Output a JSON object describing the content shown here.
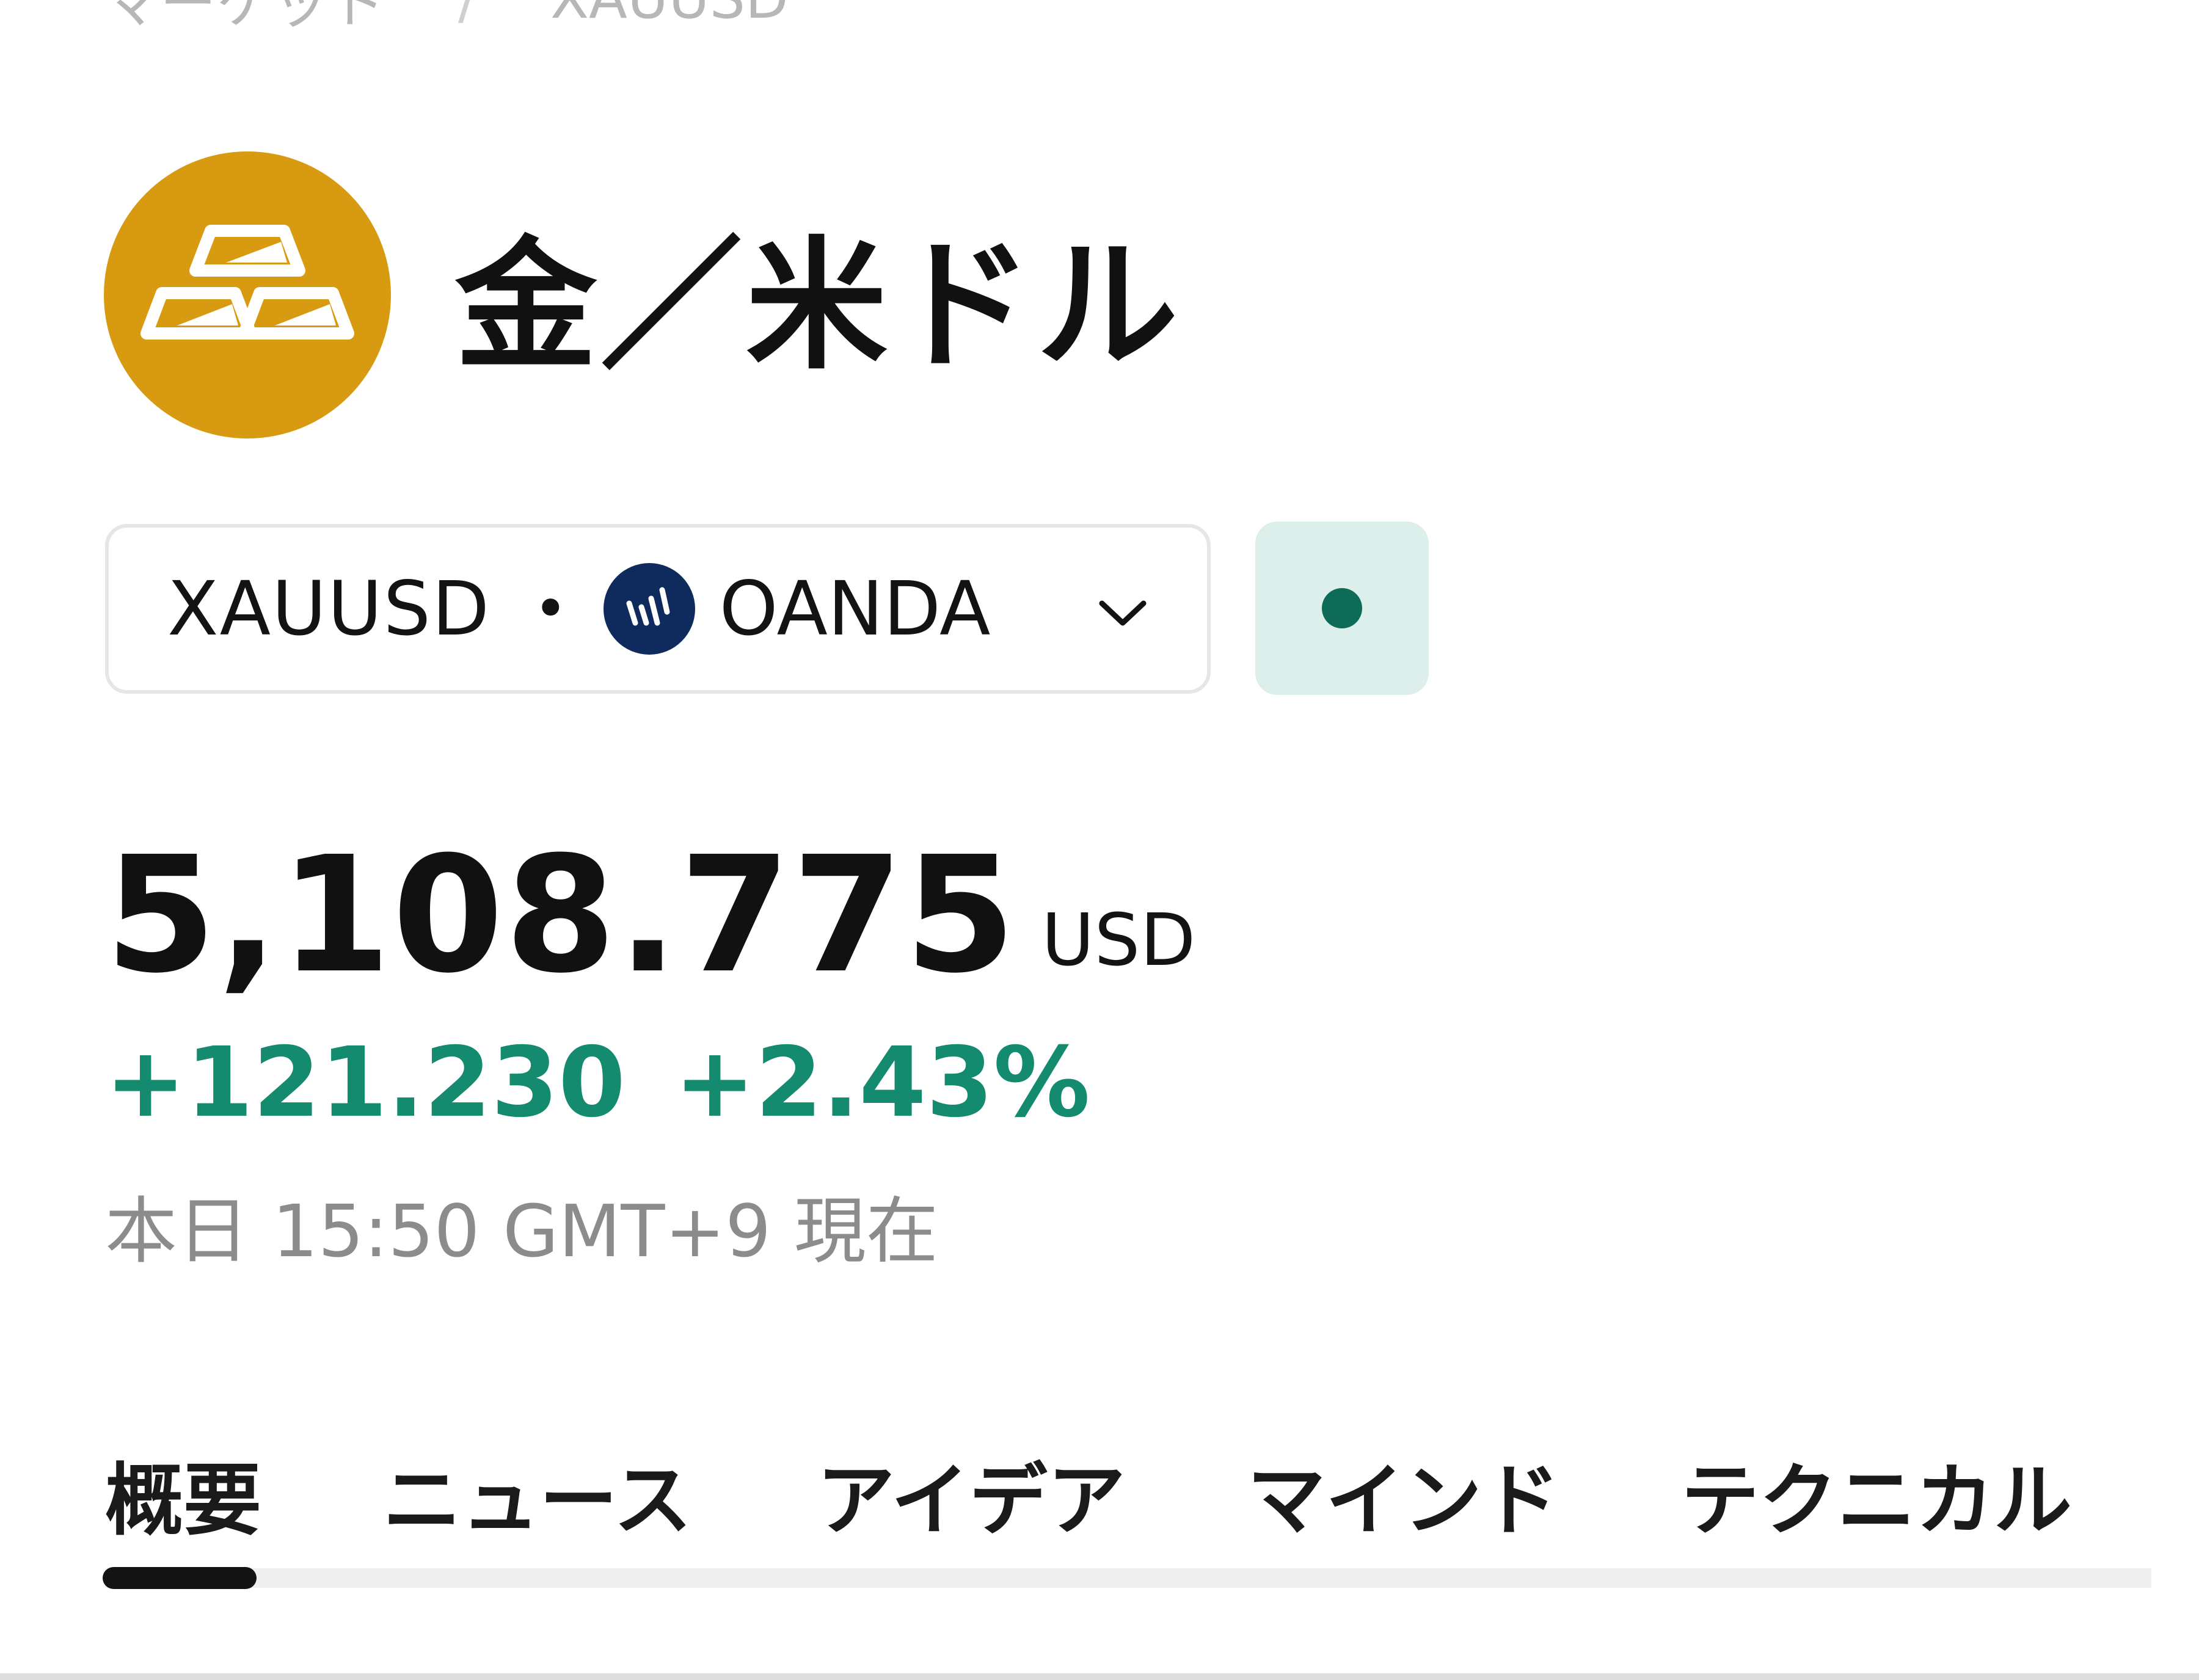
{
  "breadcrumb": {
    "items": [
      "マーケット",
      "XAUUSD"
    ],
    "separator": "/"
  },
  "asset": {
    "icon": "gold-bars-icon",
    "icon_color": "#d89a10",
    "title": "金／米ドル"
  },
  "symbol_selector": {
    "ticker": "XAUUSD",
    "separator": "•",
    "broker": "OANDA",
    "broker_logo": "oanda-logo-icon",
    "chevron": "chevron-down-icon"
  },
  "market_status": {
    "icon": "status-dot-icon",
    "color": "#0d6b58",
    "background": "#dcefeb"
  },
  "price": {
    "value": "5,108.775",
    "currency": "USD",
    "change": "+121.230",
    "change_percent": "+2.43%",
    "change_color": "#148a6e",
    "timestamp": "本日 15:50 GMT+9 現在"
  },
  "tabs": [
    {
      "label": "概要",
      "active": true
    },
    {
      "label": "ニュース",
      "active": false
    },
    {
      "label": "アイデア",
      "active": false
    },
    {
      "label": "マインド",
      "active": false
    },
    {
      "label": "テクニカル",
      "active": false
    }
  ]
}
